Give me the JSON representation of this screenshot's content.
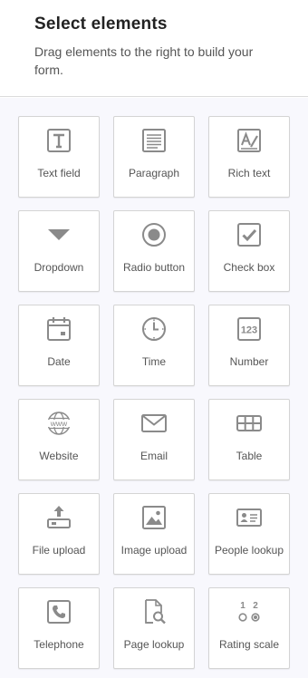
{
  "header": {
    "title": "Select elements",
    "subtitle": "Drag elements to the right to build your form."
  },
  "icon_color": "#8a8a8a",
  "elements": [
    {
      "label": "Text field",
      "icon": "text-field-icon"
    },
    {
      "label": "Paragraph",
      "icon": "paragraph-icon"
    },
    {
      "label": "Rich text",
      "icon": "rich-text-icon"
    },
    {
      "label": "Dropdown",
      "icon": "dropdown-icon"
    },
    {
      "label": "Radio button",
      "icon": "radio-button-icon"
    },
    {
      "label": "Check box",
      "icon": "check-box-icon"
    },
    {
      "label": "Date",
      "icon": "calendar-icon"
    },
    {
      "label": "Time",
      "icon": "clock-icon"
    },
    {
      "label": "Number",
      "icon": "number-icon",
      "icon_text": "123"
    },
    {
      "label": "Website",
      "icon": "globe-icon",
      "icon_text": "www"
    },
    {
      "label": "Email",
      "icon": "envelope-icon"
    },
    {
      "label": "Table",
      "icon": "table-icon"
    },
    {
      "label": "File upload",
      "icon": "file-upload-icon"
    },
    {
      "label": "Image upload",
      "icon": "image-icon"
    },
    {
      "label": "People lookup",
      "icon": "contact-card-icon"
    },
    {
      "label": "Telephone",
      "icon": "phone-icon"
    },
    {
      "label": "Page lookup",
      "icon": "page-search-icon"
    },
    {
      "label": "Rating scale",
      "icon": "rating-scale-icon",
      "icon_text": [
        "1",
        "2"
      ]
    }
  ]
}
